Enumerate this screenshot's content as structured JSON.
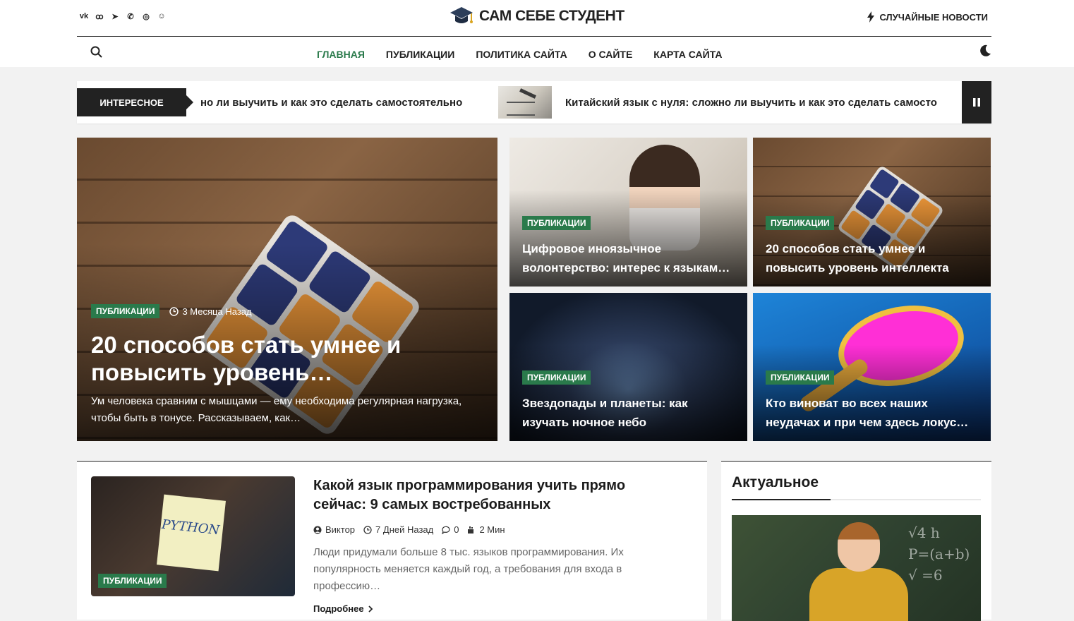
{
  "colors": {
    "accent": "#2a7a4b",
    "dark": "#222222",
    "bg": "#f2f2f2"
  },
  "header": {
    "social_icons": [
      "vk-icon",
      "odnoklassniki-icon",
      "telegram-icon",
      "viber-icon",
      "whatsapp-icon",
      "yandex-zen-icon"
    ],
    "logo_text": "САМ СЕБЕ СТУДЕНТ",
    "random_news": "СЛУЧАЙНЫЕ НОВОСТИ"
  },
  "nav": {
    "items": [
      "ГЛАВНАЯ",
      "ПУБЛИКАЦИИ",
      "ПОЛИТИКА САЙТА",
      "О САЙТЕ",
      "КАРТА САЙТА"
    ],
    "active": "ГЛАВНАЯ"
  },
  "ticker": {
    "label": "ИНТЕРЕСНОЕ",
    "item1": "но ли выучить и как это сделать самостоятельно",
    "item2": "Китайский язык с нуля: сложно ли выучить и как это сделать самосто"
  },
  "featured": {
    "main": {
      "category": "ПУБЛИКАЦИИ",
      "time": "3 Месяца Назад",
      "title": "20 способов стать умнее и повысить уровень…",
      "excerpt": "Ум человека сравним с мышцами — ему необходима регулярная нагрузка, чтобы быть в тонусе. Рассказываем, как…"
    },
    "cards": [
      {
        "category": "ПУБЛИКАЦИИ",
        "title": "Цифровое иноязычное волонтерство: интерес к языкам…"
      },
      {
        "category": "ПУБЛИКАЦИИ",
        "title": "20 способов стать умнее и повысить уровень интеллекта"
      },
      {
        "category": "ПУБЛИКАЦИИ",
        "title": "Звездопады и планеты: как изучать ночное небо"
      },
      {
        "category": "ПУБЛИКАЦИИ",
        "title": "Кто виноват во всех наших неудачах и при чем здесь локус…"
      }
    ]
  },
  "post": {
    "category": "ПУБЛИКАЦИИ",
    "thumb_text": "PYTHON",
    "title": "Какой язык программирования учить прямо сейчас: 9 самых востребованных",
    "author": "Виктор",
    "date": "7 Дней Назад",
    "comments": "0",
    "read_time": "2 Мин",
    "excerpt": "Люди придумали больше 8 тыс. языков программирования. Их популярность меняется каждый год, а требования для входа в профессию…",
    "read_more": "Подробнее"
  },
  "sidebar": {
    "title": "Актуальное"
  }
}
